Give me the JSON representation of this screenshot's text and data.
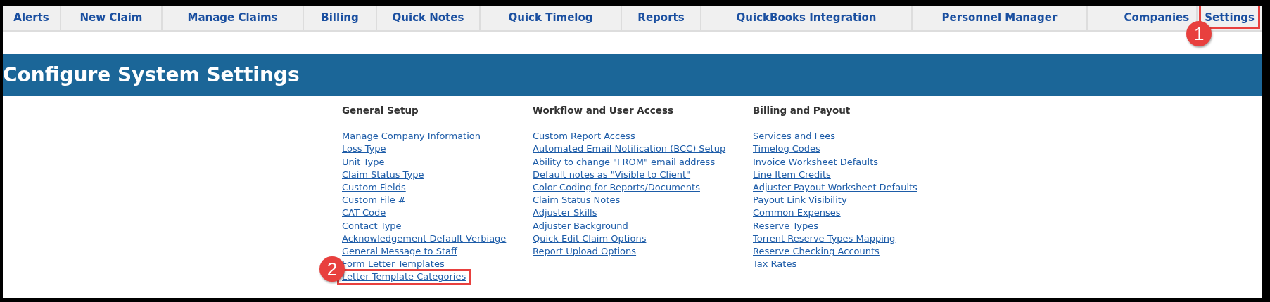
{
  "nav": {
    "tabs": [
      {
        "label": "Alerts"
      },
      {
        "label": "New Claim"
      },
      {
        "label": "Manage Claims"
      },
      {
        "label": "Billing"
      },
      {
        "label": "Quick Notes"
      },
      {
        "label": "Quick Timelog"
      },
      {
        "label": "Reports"
      },
      {
        "label": "QuickBooks Integration"
      },
      {
        "label": "Personnel Manager"
      },
      {
        "label": "Companies"
      },
      {
        "label": "Settings",
        "callout": "1"
      }
    ]
  },
  "header": {
    "title": "Configure System Settings"
  },
  "sections": [
    {
      "heading": "General Setup",
      "links": [
        {
          "label": "Manage Company Information"
        },
        {
          "label": "Loss Type"
        },
        {
          "label": "Unit Type"
        },
        {
          "label": "Claim Status Type"
        },
        {
          "label": "Custom Fields"
        },
        {
          "label": "Custom File #"
        },
        {
          "label": "CAT Code"
        },
        {
          "label": "Contact Type"
        },
        {
          "label": "Acknowledgement Default Verbiage"
        },
        {
          "label": "General Message to Staff"
        },
        {
          "label": "Form Letter Templates"
        },
        {
          "label": "Letter Template Categories",
          "callout": "2"
        }
      ]
    },
    {
      "heading": "Workflow and User Access",
      "links": [
        {
          "label": "Custom Report Access"
        },
        {
          "label": "Automated Email Notification (BCC) Setup"
        },
        {
          "label": "Ability to change \"FROM\" email address"
        },
        {
          "label": "Default notes as \"Visible to Client\""
        },
        {
          "label": "Color Coding for Reports/Documents"
        },
        {
          "label": "Claim Status Notes"
        },
        {
          "label": "Adjuster Skills"
        },
        {
          "label": "Adjuster Background"
        },
        {
          "label": "Quick Edit Claim Options"
        },
        {
          "label": "Report Upload Options"
        }
      ]
    },
    {
      "heading": "Billing and Payout",
      "links": [
        {
          "label": "Services and Fees"
        },
        {
          "label": "Timelog Codes"
        },
        {
          "label": "Invoice Worksheet Defaults"
        },
        {
          "label": "Line Item Credits"
        },
        {
          "label": "Adjuster Payout Worksheet Defaults"
        },
        {
          "label": "Payout Link Visibility"
        },
        {
          "label": "Common Expenses"
        },
        {
          "label": "Reserve Types"
        },
        {
          "label": "Torrent Reserve Types Mapping"
        },
        {
          "label": "Reserve Checking Accounts"
        },
        {
          "label": "Tax Rates"
        }
      ]
    }
  ]
}
